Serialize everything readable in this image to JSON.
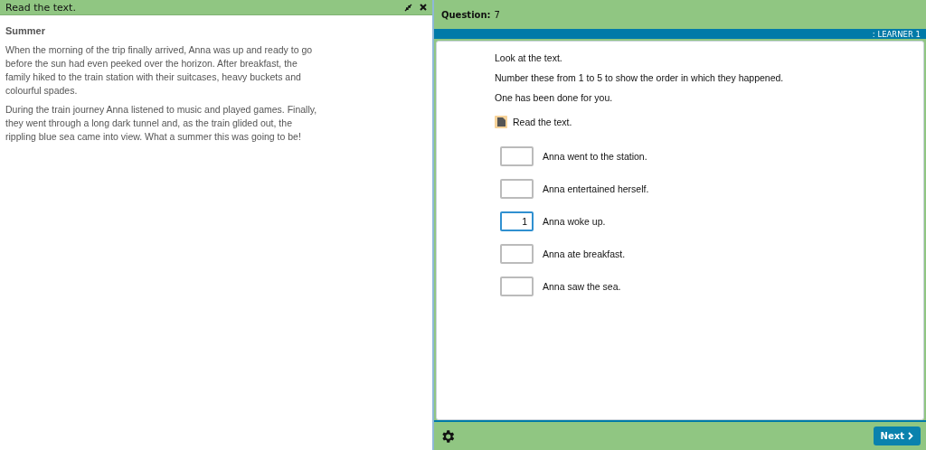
{
  "reader_panel": {
    "title": "Read the text.",
    "heading": "Summer",
    "paragraphs": [
      "When the morning of the trip finally arrived, Anna was up and ready to go before the sun had even peeked over the horizon. After breakfast, the family hiked to the train station with their suitcases, heavy buckets and colourful spades.",
      "During the train journey Anna listened to music and played games. Finally, they went through a long dark tunnel and, as the train glided out, the rippling blue sea came into view. What a summer this was going to be!"
    ]
  },
  "header": {
    "question_label": "Question:",
    "question_number": "7",
    "learner": ": LEARNER 1"
  },
  "instructions": [
    "Look at the text.",
    "Number these from 1 to 5  to show the order in which they happened.",
    "One has been done for you."
  ],
  "source_link": "Read the text.",
  "answers": [
    {
      "label": "Anna went to the station.",
      "selected": false
    },
    {
      "label": "Anna entertained herself.",
      "selected": false
    },
    {
      "value": "1",
      "label": "Anna woke up.",
      "selected": true
    },
    {
      "label": "Anna ate breakfast.",
      "selected": false
    },
    {
      "label": "Anna saw the sea.",
      "selected": false
    }
  ],
  "footer": {
    "next_button": "Next"
  }
}
